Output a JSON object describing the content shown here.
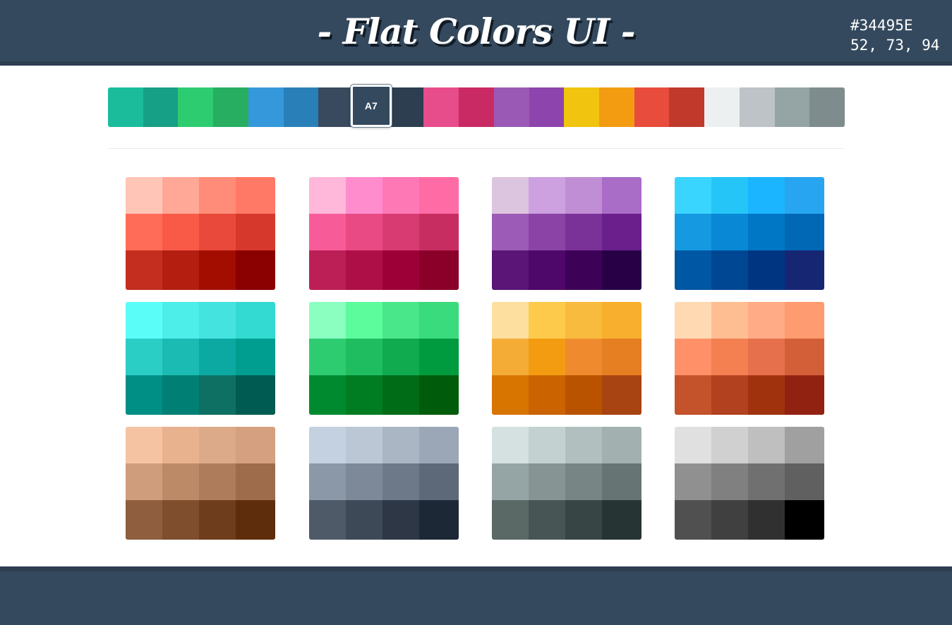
{
  "header": {
    "title": "- Flat Colors UI -",
    "selected_hex": "#34495E",
    "selected_rgb": "52, 73, 94",
    "background": "#34495E"
  },
  "palette": {
    "selected_label": "A7",
    "selected_index": 7,
    "colors": [
      "#1ABC9C",
      "#16A085",
      "#2ECC71",
      "#27AE60",
      "#3498DB",
      "#2980B9",
      "#3A4A5E",
      "#34495E",
      "#2C3E50",
      "#E74C8B",
      "#C92A63",
      "#9B59B6",
      "#8E44AD",
      "#F1C40F",
      "#F39C12",
      "#E74C3C",
      "#C0392B",
      "#ECF0F1",
      "#BDC3C7",
      "#95A5A6",
      "#7F8C8D"
    ]
  },
  "shade_groups": [
    {
      "name": "red",
      "colors": [
        "#FFC6B8",
        "#FFA897",
        "#FF8C79",
        "#FF7966",
        "#FF6C58",
        "#F85A47",
        "#E8493A",
        "#D6392C",
        "#C42E1F",
        "#B31E10",
        "#A30D00",
        "#8B0000"
      ]
    },
    {
      "name": "pink",
      "colors": [
        "#FFB8D9",
        "#FF8DCD",
        "#FF78B6",
        "#FF6BA5",
        "#F75C98",
        "#E94A84",
        "#D83B72",
        "#C82D62",
        "#BC1F56",
        "#AE0F47",
        "#9D0037",
        "#8A0029"
      ]
    },
    {
      "name": "purple",
      "colors": [
        "#DCC5DE",
        "#CDA0E0",
        "#C08ED4",
        "#A96CC7",
        "#9C5BB6",
        "#8B43A6",
        "#7A3198",
        "#6A1F8C",
        "#5A1577",
        "#4E0869",
        "#3D0258",
        "#270046"
      ]
    },
    {
      "name": "blue",
      "colors": [
        "#3AD5FF",
        "#25C5F8",
        "#1BB5FF",
        "#28A5F0",
        "#1599E1",
        "#0888D5",
        "#0077C5",
        "#0068B5",
        "#0057A3",
        "#004793",
        "#003582",
        "#162673"
      ]
    },
    {
      "name": "teal",
      "colors": [
        "#5BFDF8",
        "#4DEDEA",
        "#45E3DF",
        "#32DAD1",
        "#2BCEC5",
        "#1BBAB2",
        "#0BA9A2",
        "#009D91",
        "#008F85",
        "#007F75",
        "#0E6F63",
        "#005C52"
      ]
    },
    {
      "name": "green",
      "colors": [
        "#8AFFC0",
        "#5CFB9C",
        "#4AE68A",
        "#3ADB7D",
        "#2ECC71",
        "#20BD60",
        "#0FAB4E",
        "#009A3F",
        "#008A30",
        "#007C22",
        "#006C17",
        "#005C0A"
      ]
    },
    {
      "name": "yellow",
      "colors": [
        "#FDE09F",
        "#FECA4B",
        "#F8BB3D",
        "#F7AF2D",
        "#F4AC37",
        "#F39C12",
        "#F08A2F",
        "#E67E22",
        "#D87400",
        "#CA6300",
        "#B95300",
        "#A84312"
      ]
    },
    {
      "name": "orange",
      "colors": [
        "#FFD9B2",
        "#FFBE92",
        "#FFAB86",
        "#FF9B70",
        "#FF9068",
        "#F47F51",
        "#E5704B",
        "#D35F38",
        "#C4522A",
        "#B2411F",
        "#A0330D",
        "#912212"
      ]
    },
    {
      "name": "tan",
      "colors": [
        "#F5C3A2",
        "#E8B28F",
        "#DDAA89",
        "#D5A07F",
        "#CF9C7C",
        "#BD8A68",
        "#AE7C5B",
        "#9E6C4B",
        "#8E5E3E",
        "#7E4E2D",
        "#6E3D1C",
        "#5E2D0C"
      ]
    },
    {
      "name": "slate",
      "colors": [
        "#C4D1E0",
        "#BCC7D6",
        "#AAB6C4",
        "#9BA7B6",
        "#8B98A8",
        "#7D8998",
        "#6D7988",
        "#5D6978",
        "#4F5A69",
        "#3E4958",
        "#2D3746",
        "#1D2837"
      ]
    },
    {
      "name": "gray-green",
      "colors": [
        "#D5E1E1",
        "#C4D1D1",
        "#B1BFBF",
        "#A2B0B0",
        "#95A5A5",
        "#869594",
        "#778685",
        "#667574",
        "#5A6866",
        "#475654",
        "#374544",
        "#263433"
      ]
    },
    {
      "name": "gray",
      "colors": [
        "#E0E0E0",
        "#D0D0D0",
        "#BFBFBF",
        "#A0A0A0",
        "#909090",
        "#808080",
        "#707070",
        "#606060",
        "#505050",
        "#404040",
        "#303030",
        "#000000"
      ]
    }
  ]
}
